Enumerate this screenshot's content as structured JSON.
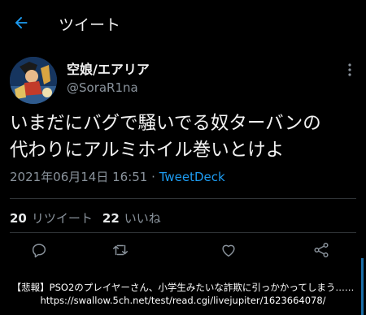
{
  "header": {
    "title": "ツイート",
    "back_icon": "arrow-left-icon"
  },
  "user": {
    "display_name": "空娘/エアリア",
    "handle": "@SoraR1na"
  },
  "tweet": {
    "text_line1": "いまだにバグで騒いでる奴ターバンの",
    "text_line2": "代わりにアルミホイル巻いとけよ",
    "timestamp": "2021年06月14日 16:51",
    "separator": "·",
    "source": "TweetDeck"
  },
  "stats": {
    "retweets_count": "20",
    "retweets_label": "リツイート",
    "likes_count": "22",
    "likes_label": "いいね"
  },
  "actions": [
    "reply-icon",
    "retweet-icon",
    "like-icon",
    "share-icon"
  ],
  "caption": {
    "line1": "【悲報】PSO2のプレイヤーさん、小学生みたいな詐欺に引っかかってしまう……",
    "line2": "https://swallow.5ch.net/test/read.cgi/livejupiter/1623664078/"
  },
  "colors": {
    "background": "#000000",
    "link": "#1d9bf0",
    "muted": "#8a939c"
  }
}
